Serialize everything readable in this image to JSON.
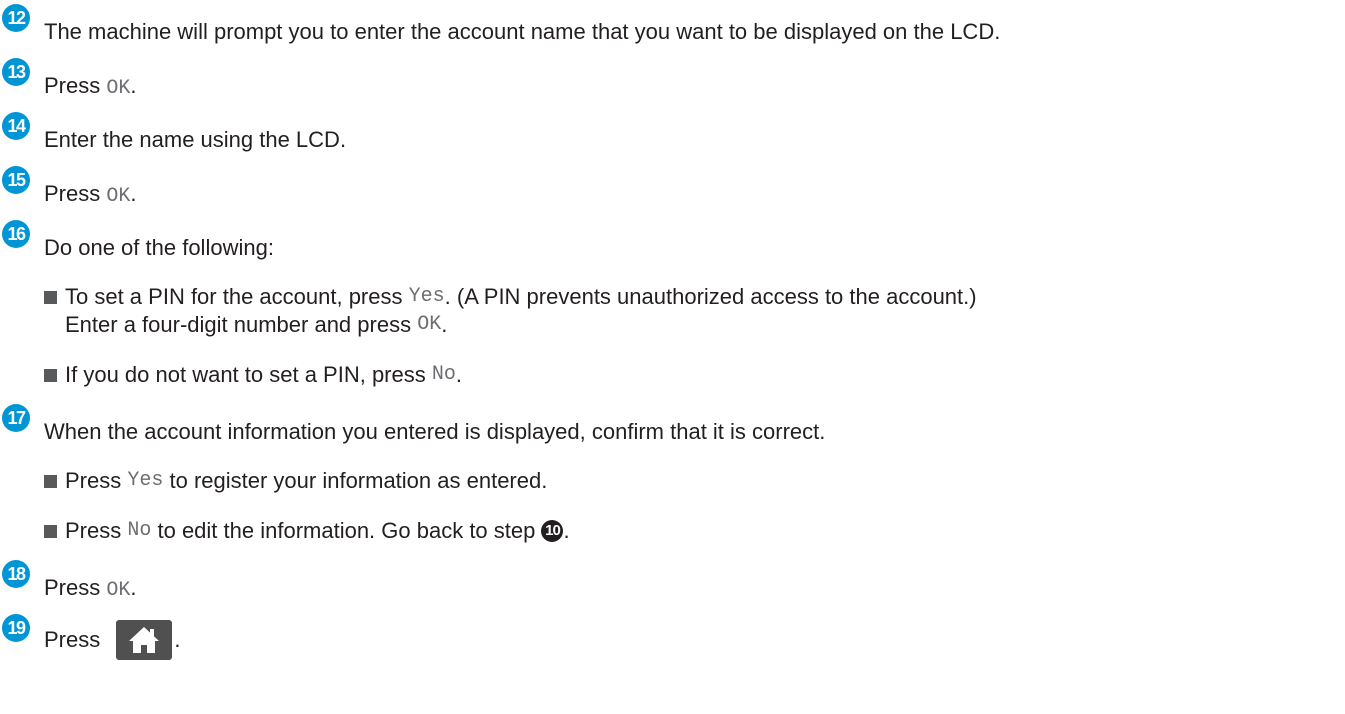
{
  "steps": {
    "s12": {
      "num": "12",
      "text": "The machine will prompt you to enter the account name that you want to be displayed on the LCD."
    },
    "s13": {
      "num": "13",
      "pre": "Press ",
      "code": "OK",
      "post": "."
    },
    "s14": {
      "num": "14",
      "text": "Enter the name using the LCD."
    },
    "s15": {
      "num": "15",
      "pre": "Press ",
      "code": "OK",
      "post": "."
    },
    "s16": {
      "num": "16",
      "text": "Do one of the following:",
      "b1": {
        "pre": "To set a PIN for the account, press ",
        "code": "Yes",
        "post": ". (A PIN prevents unauthorized access to the account.)",
        "line2pre": "Enter a four-digit number and press ",
        "line2code": "OK",
        "line2post": "."
      },
      "b2": {
        "pre": "If you do not want to set a PIN, press ",
        "code": "No",
        "post": "."
      }
    },
    "s17": {
      "num": "17",
      "text": "When the account information you entered is displayed, confirm that it is correct.",
      "b1": {
        "pre": "Press ",
        "code": "Yes",
        "post": " to register your information as entered."
      },
      "b2": {
        "pre": "Press ",
        "code": "No",
        "post": " to edit the information. Go back to step ",
        "ref": "10",
        "end": "."
      }
    },
    "s18": {
      "num": "18",
      "pre": "Press ",
      "code": "OK",
      "post": "."
    },
    "s19": {
      "num": "19",
      "pre": "Press ",
      "icon": "home-icon",
      "post": "."
    }
  },
  "colors": {
    "step_badge": "#0096d6",
    "text": "#231f20",
    "code": "#6d6e71",
    "home_button": "#505050"
  }
}
